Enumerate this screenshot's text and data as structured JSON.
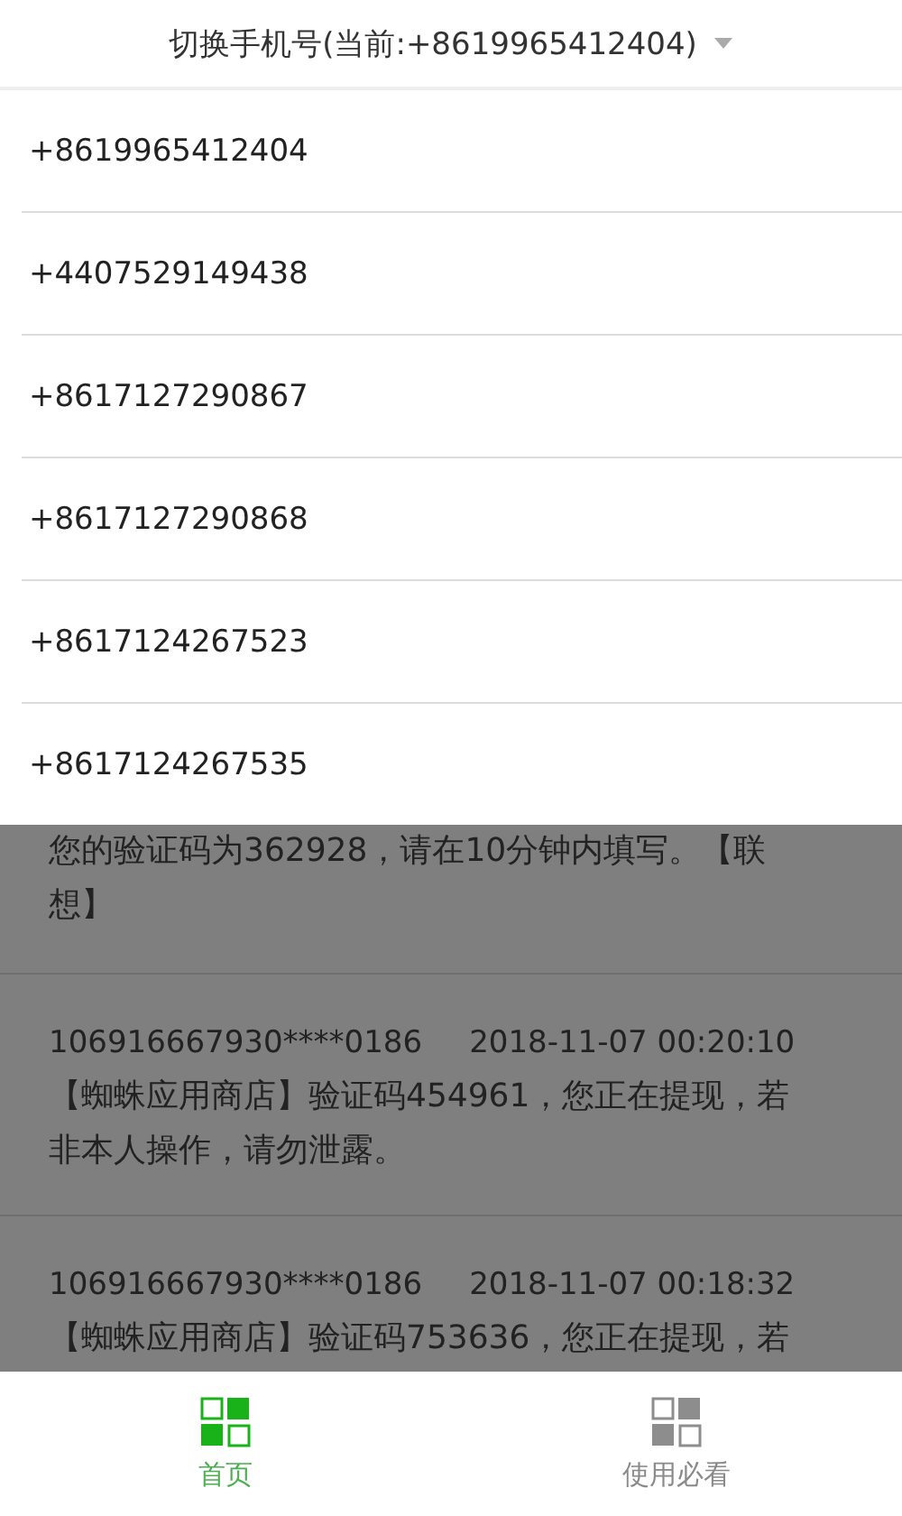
{
  "header": {
    "title": "切换手机号(当前:+8619965412404)"
  },
  "phone_options": [
    {
      "number": "+8619965412404"
    },
    {
      "number": "+4407529149438"
    },
    {
      "number": "+8617127290867"
    },
    {
      "number": "+8617127290868"
    },
    {
      "number": "+8617124267523"
    },
    {
      "number": "+8617124267535"
    }
  ],
  "messages": [
    {
      "body": "您的验证码为362928，请在10分钟内填写。【联想】"
    },
    {
      "sender": "106916667930****0186",
      "time": "2018-11-07 00:20:10",
      "body": "【蜘蛛应用商店】验证码454961，您正在提现，若非本人操作，请勿泄露。"
    },
    {
      "sender": "106916667930****0186",
      "time": "2018-11-07 00:18:32",
      "body": "【蜘蛛应用商店】验证码753636，您正在提现，若"
    }
  ],
  "tabs": [
    {
      "label": "首页",
      "selected": true
    },
    {
      "label": "使用必看",
      "selected": false
    }
  ]
}
